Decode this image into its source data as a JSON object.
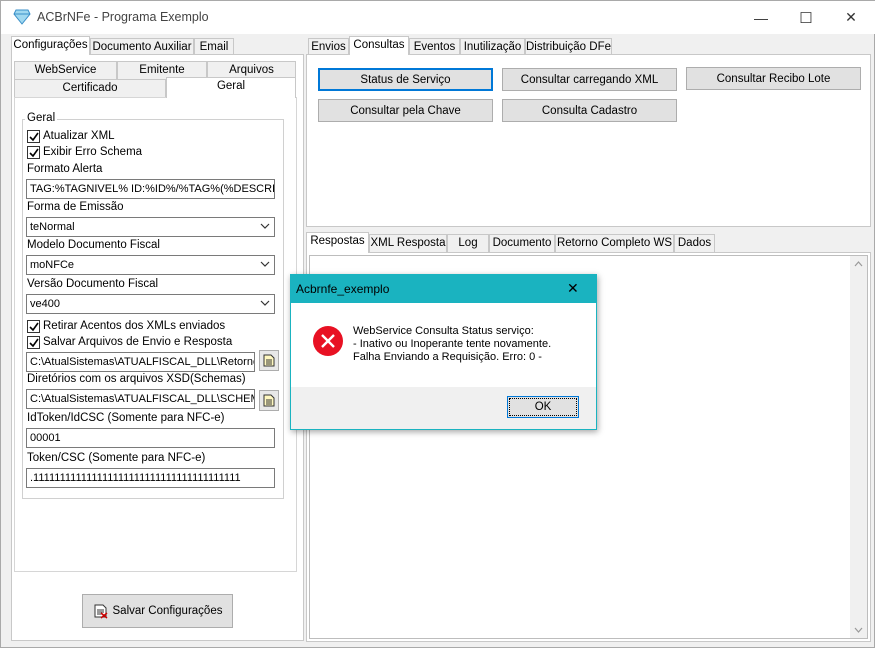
{
  "window": {
    "title": "ACBrNFe - Programa Exemplo",
    "minimize": "—",
    "maximize": "☐",
    "close": "✕"
  },
  "left_tabs": [
    "Configurações",
    "Documento Auxiliar",
    "Email"
  ],
  "config_tabs_row1": [
    "WebService",
    "Emitente",
    "Arquivos"
  ],
  "config_tabs_row2": [
    "Certificado",
    "Geral"
  ],
  "geral": {
    "group_title": "Geral",
    "atualizar_xml": {
      "label": "Atualizar XML",
      "checked": true
    },
    "exibir_erro_schema": {
      "label": "Exibir Erro Schema",
      "checked": true
    },
    "formato_alerta_label": "Formato Alerta",
    "formato_alerta_value": "TAG:%TAGNIVEL% ID:%ID%/%TAG%(%DESCRI",
    "forma_emissao_label": "Forma de Emissão",
    "forma_emissao_value": "teNormal",
    "modelo_label": "Modelo Documento Fiscal",
    "modelo_value": "moNFCe",
    "versao_label": "Versão Documento Fiscal",
    "versao_value": "ve400",
    "retirar_acentos": {
      "label": "Retirar Acentos dos XMLs enviados",
      "checked": true
    },
    "salvar_arquivos": {
      "label": "Salvar Arquivos de Envio e Resposta",
      "checked": true
    },
    "retornos_path": "C:\\AtualSistemas\\ATUALFISCAL_DLL\\Retornos",
    "xsd_label": "Diretórios com os arquivos XSD(Schemas)",
    "xsd_path": "C:\\AtualSistemas\\ATUALFISCAL_DLL\\SCHEMAS",
    "idtoken_label": "IdToken/IdCSC (Somente para NFC-e)",
    "idtoken_value": "00001",
    "token_label": "Token/CSC (Somente para NFC-e)",
    "token_value": ".111111111111111111111111111111111111111"
  },
  "save_button": "Salvar Configurações",
  "right_tabs": [
    "Envios",
    "Consultas",
    "Eventos",
    "Inutilização",
    "Distribuição DFe"
  ],
  "consult_buttons": {
    "status": "Status de Serviço",
    "xml": "Consultar carregando XML",
    "recibo": "Consultar Recibo Lote",
    "chave": "Consultar pela Chave",
    "cadastro": "Consulta Cadastro"
  },
  "result_tabs": [
    "Respostas",
    "XML Resposta",
    "Log",
    "Documento",
    "Retorno Completo WS",
    "Dados"
  ],
  "dialog": {
    "title": "Acbrnfe_exemplo",
    "close": "✕",
    "line1": "WebService Consulta Status serviço:",
    "line2": "- Inativo ou Inoperante tente novamente.",
    "line3": "Falha Enviando a Requisição. Erro: 0 -",
    "ok": "OK"
  },
  "colors": {
    "dialog_titlebar": "#1ab3c0",
    "error_icon": "#e81123",
    "focus_border": "#0078d7"
  }
}
